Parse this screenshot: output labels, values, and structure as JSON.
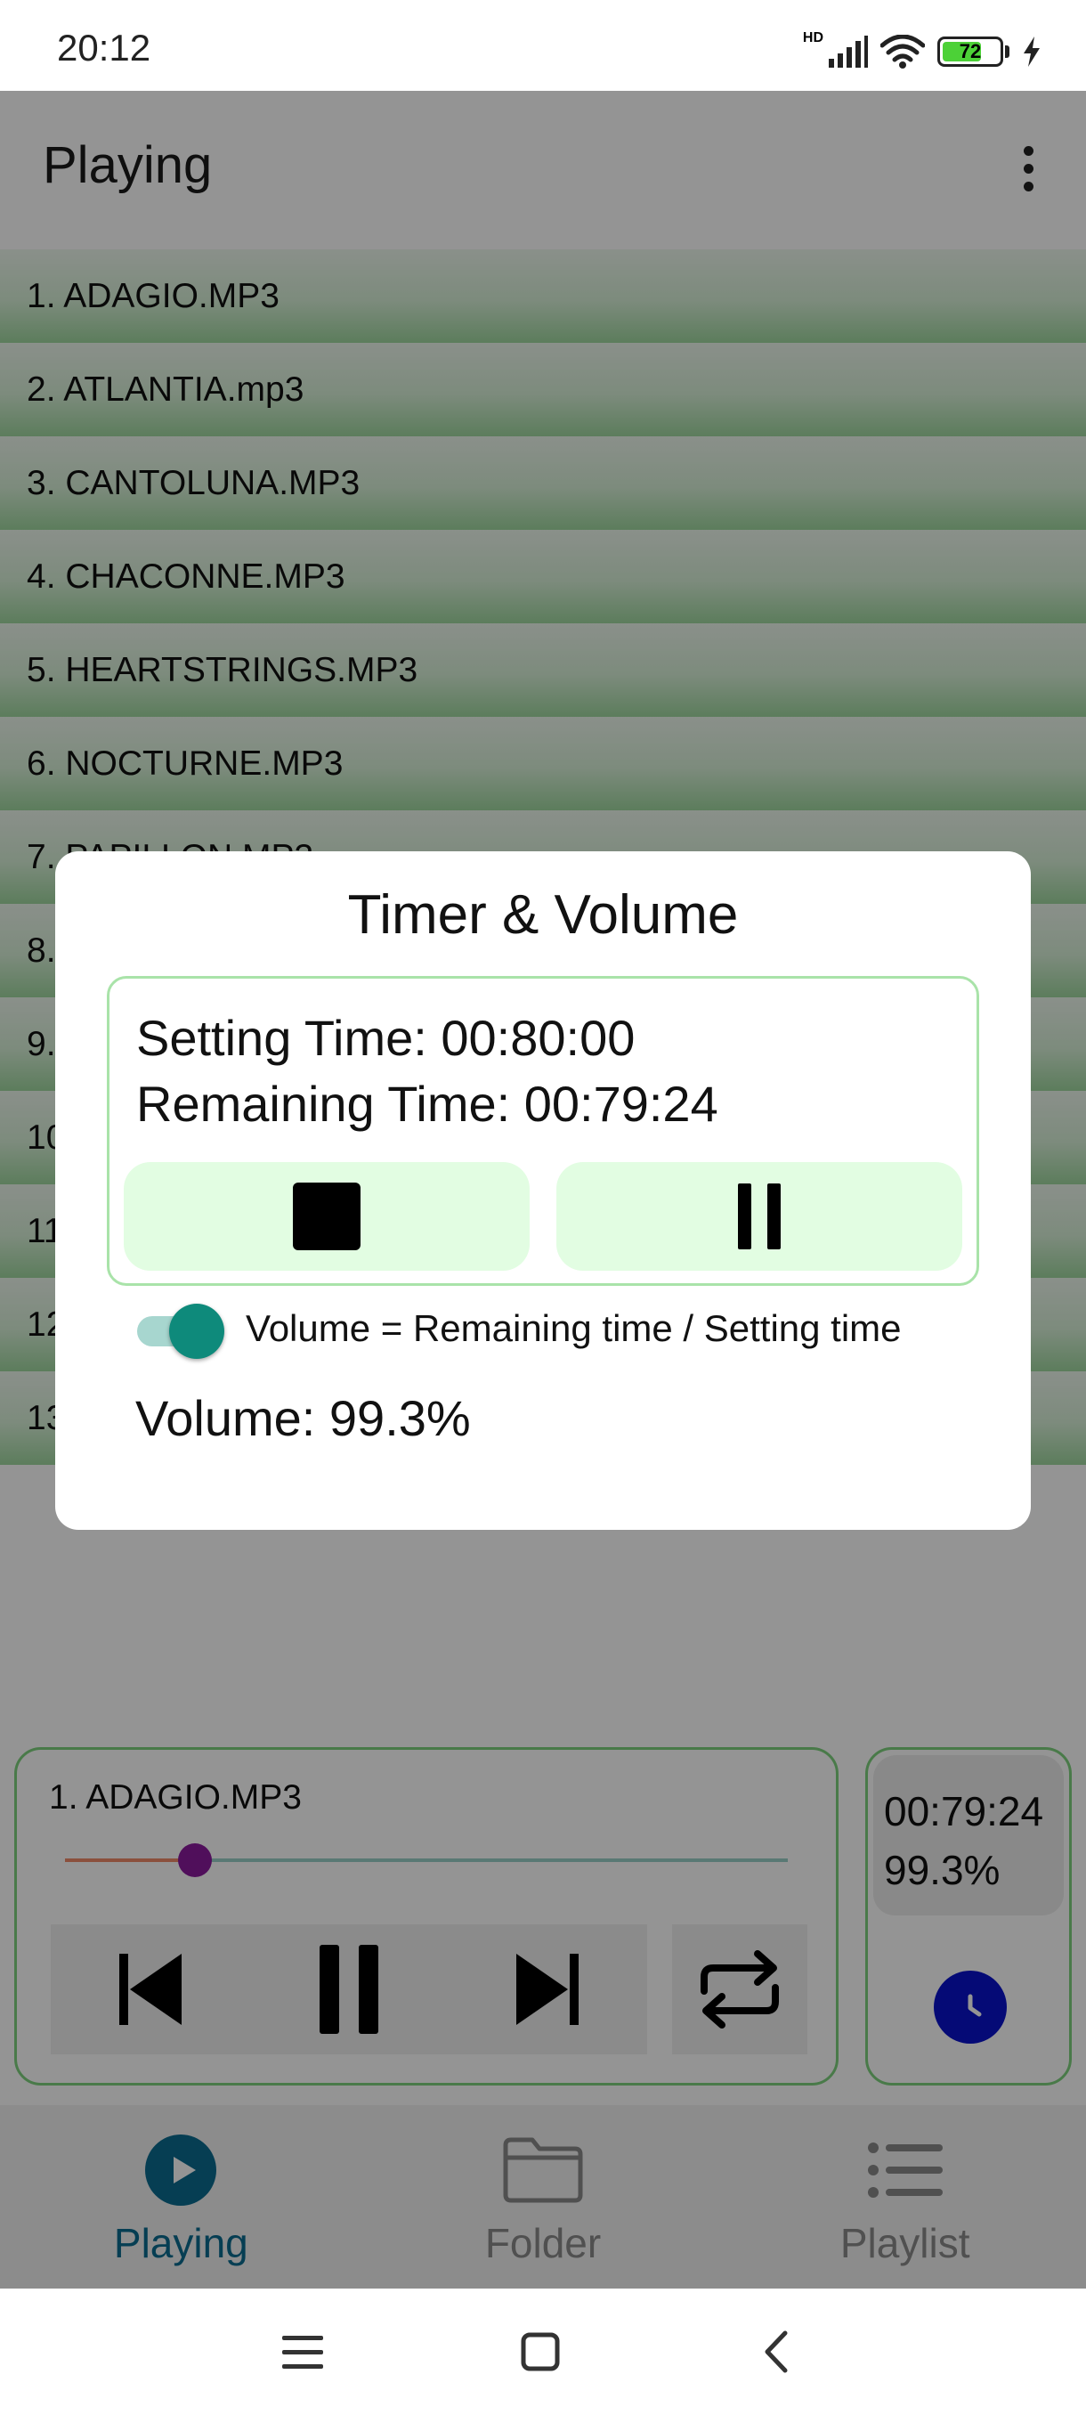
{
  "status_bar": {
    "time": "20:12",
    "battery": "72",
    "network": "HD"
  },
  "app": {
    "title": "Playing"
  },
  "tracks": [
    "1. ADAGIO.MP3",
    "2. ATLANTIA.mp3",
    "3. CANTOLUNA.MP3",
    "4. CHACONNE.MP3",
    "5. HEARTSTRINGS.MP3",
    "6. NOCTURNE.MP3",
    "7. PAPILLON.MP3",
    "8.",
    "9.",
    "10",
    "11",
    "12",
    "13"
  ],
  "player": {
    "current_track": "1. ADAGIO.MP3",
    "progress": 0.18
  },
  "timer_card": {
    "remaining": "00:79:24",
    "volume": "99.3%"
  },
  "nav": {
    "playing": "Playing",
    "folder": "Folder",
    "playlist": "Playlist"
  },
  "dialog": {
    "title": "Timer & Volume",
    "setting_time": "Setting Time: 00:80:00",
    "remaining_time": "Remaining Time: 00:79:24",
    "switch_label": "Volume = Remaining time / Setting time",
    "switch_on": true,
    "volume": "Volume: 99.3%"
  },
  "colors": {
    "accent": "#0e8a7b",
    "nav_active": "#0c6b8f",
    "seek_thumb": "#8b1a9e",
    "clock": "#0a12cc",
    "card_border": "#7fd37f"
  }
}
